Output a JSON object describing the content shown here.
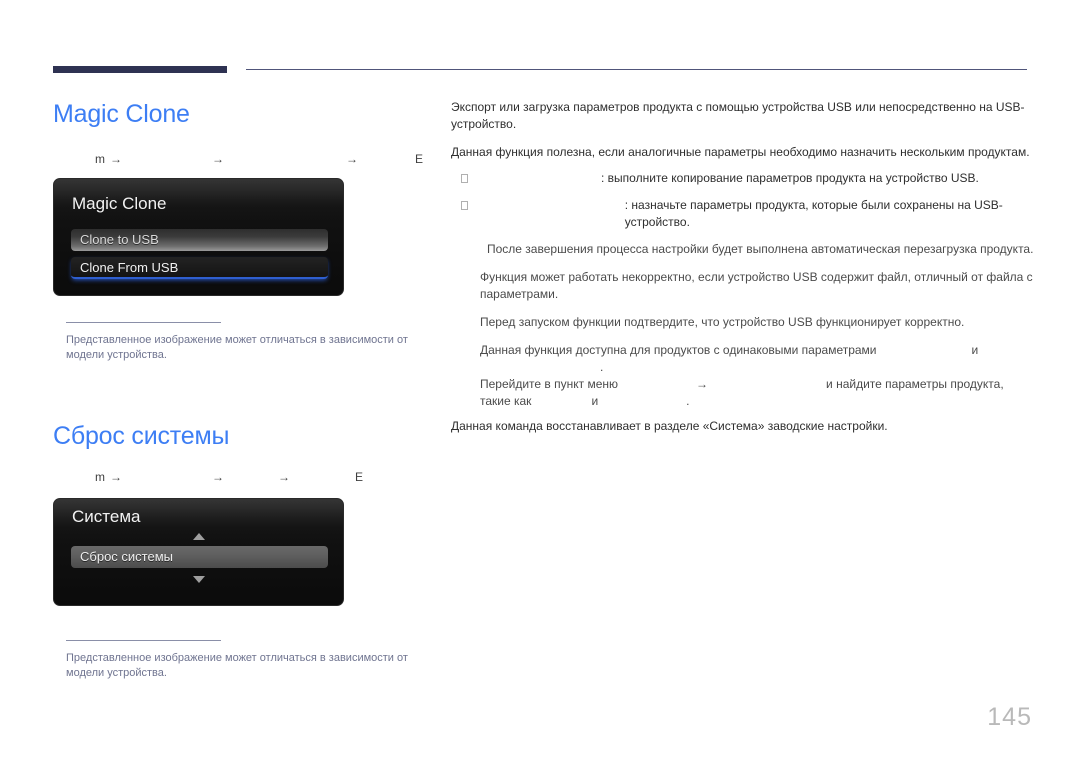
{
  "page": {
    "number": "145"
  },
  "sections": [
    {
      "id": "magic-clone",
      "title": "Magic Clone",
      "menu_path": {
        "home_glyph": "m",
        "arrow": "→",
        "enter_glyph": "E",
        "segments": [
          "",
          "",
          ""
        ]
      },
      "osd": {
        "title": "Magic Clone",
        "items": [
          {
            "label": "Clone to USB",
            "state": "selected"
          },
          {
            "label": "Clone From USB",
            "state": "normal"
          }
        ]
      },
      "caption": "Представленное изображение может отличаться в зависимости от модели устройства.",
      "body": {
        "intro": "Экспорт или загрузка параметров продукта с помощью устройства USB или непосредственно на USB-устройство.",
        "usefulness": "Данная функция полезна, если аналогичные параметры необходимо назначить нескольким продуктам.",
        "bullets": [
          {
            "term": "",
            "text": ": выполните копирование параметров продукта на устройство USB."
          },
          {
            "term": "",
            "text": ": назначьте параметры продукта, которые были сохранены на USB-устройство."
          }
        ],
        "reboot_note": "После завершения процесса настройки будет выполнена автоматическая перезагрузка продукта.",
        "notes": [
          "Функция может работать некорректно, если устройство USB содержит файл, отличный от файла с параметрами.",
          "Перед запуском функции подтвердите, что устройство USB функционирует корректно."
        ],
        "compat": {
          "line1_a": "Данная функция доступна для продуктов с одинаковыми параметрами",
          "line1_and": "и",
          "line1_end": ".",
          "line2_a": "Перейдите в пункт меню",
          "line2_arrow": "→",
          "line2_b": "и найдите параметры продукта,",
          "line3_a": "такие как",
          "line3_and": "и",
          "line3_end": "."
        }
      }
    },
    {
      "id": "system-reset",
      "title": "Сброс системы",
      "menu_path": {
        "home_glyph": "m",
        "arrow": "→",
        "enter_glyph": "E",
        "segments": [
          "",
          "",
          ""
        ]
      },
      "osd": {
        "title": "Система",
        "scroll_up": "▲",
        "scroll_down": "▼",
        "items": [
          {
            "label": "Сброс системы",
            "state": "selected"
          }
        ]
      },
      "caption": "Представленное изображение может отличаться в зависимости от модели устройства.",
      "body": {
        "intro": "Данная команда восстанавливает в разделе «Система» заводские настройки."
      }
    }
  ],
  "colors": {
    "heading_blue": "#3d7ef4",
    "header_bar_navy": "#2e3252",
    "caption_gray_blue": "#6f7490",
    "osd_highlight_blue": "#2f5fd0",
    "page_number_gray": "#b9b9b9"
  }
}
